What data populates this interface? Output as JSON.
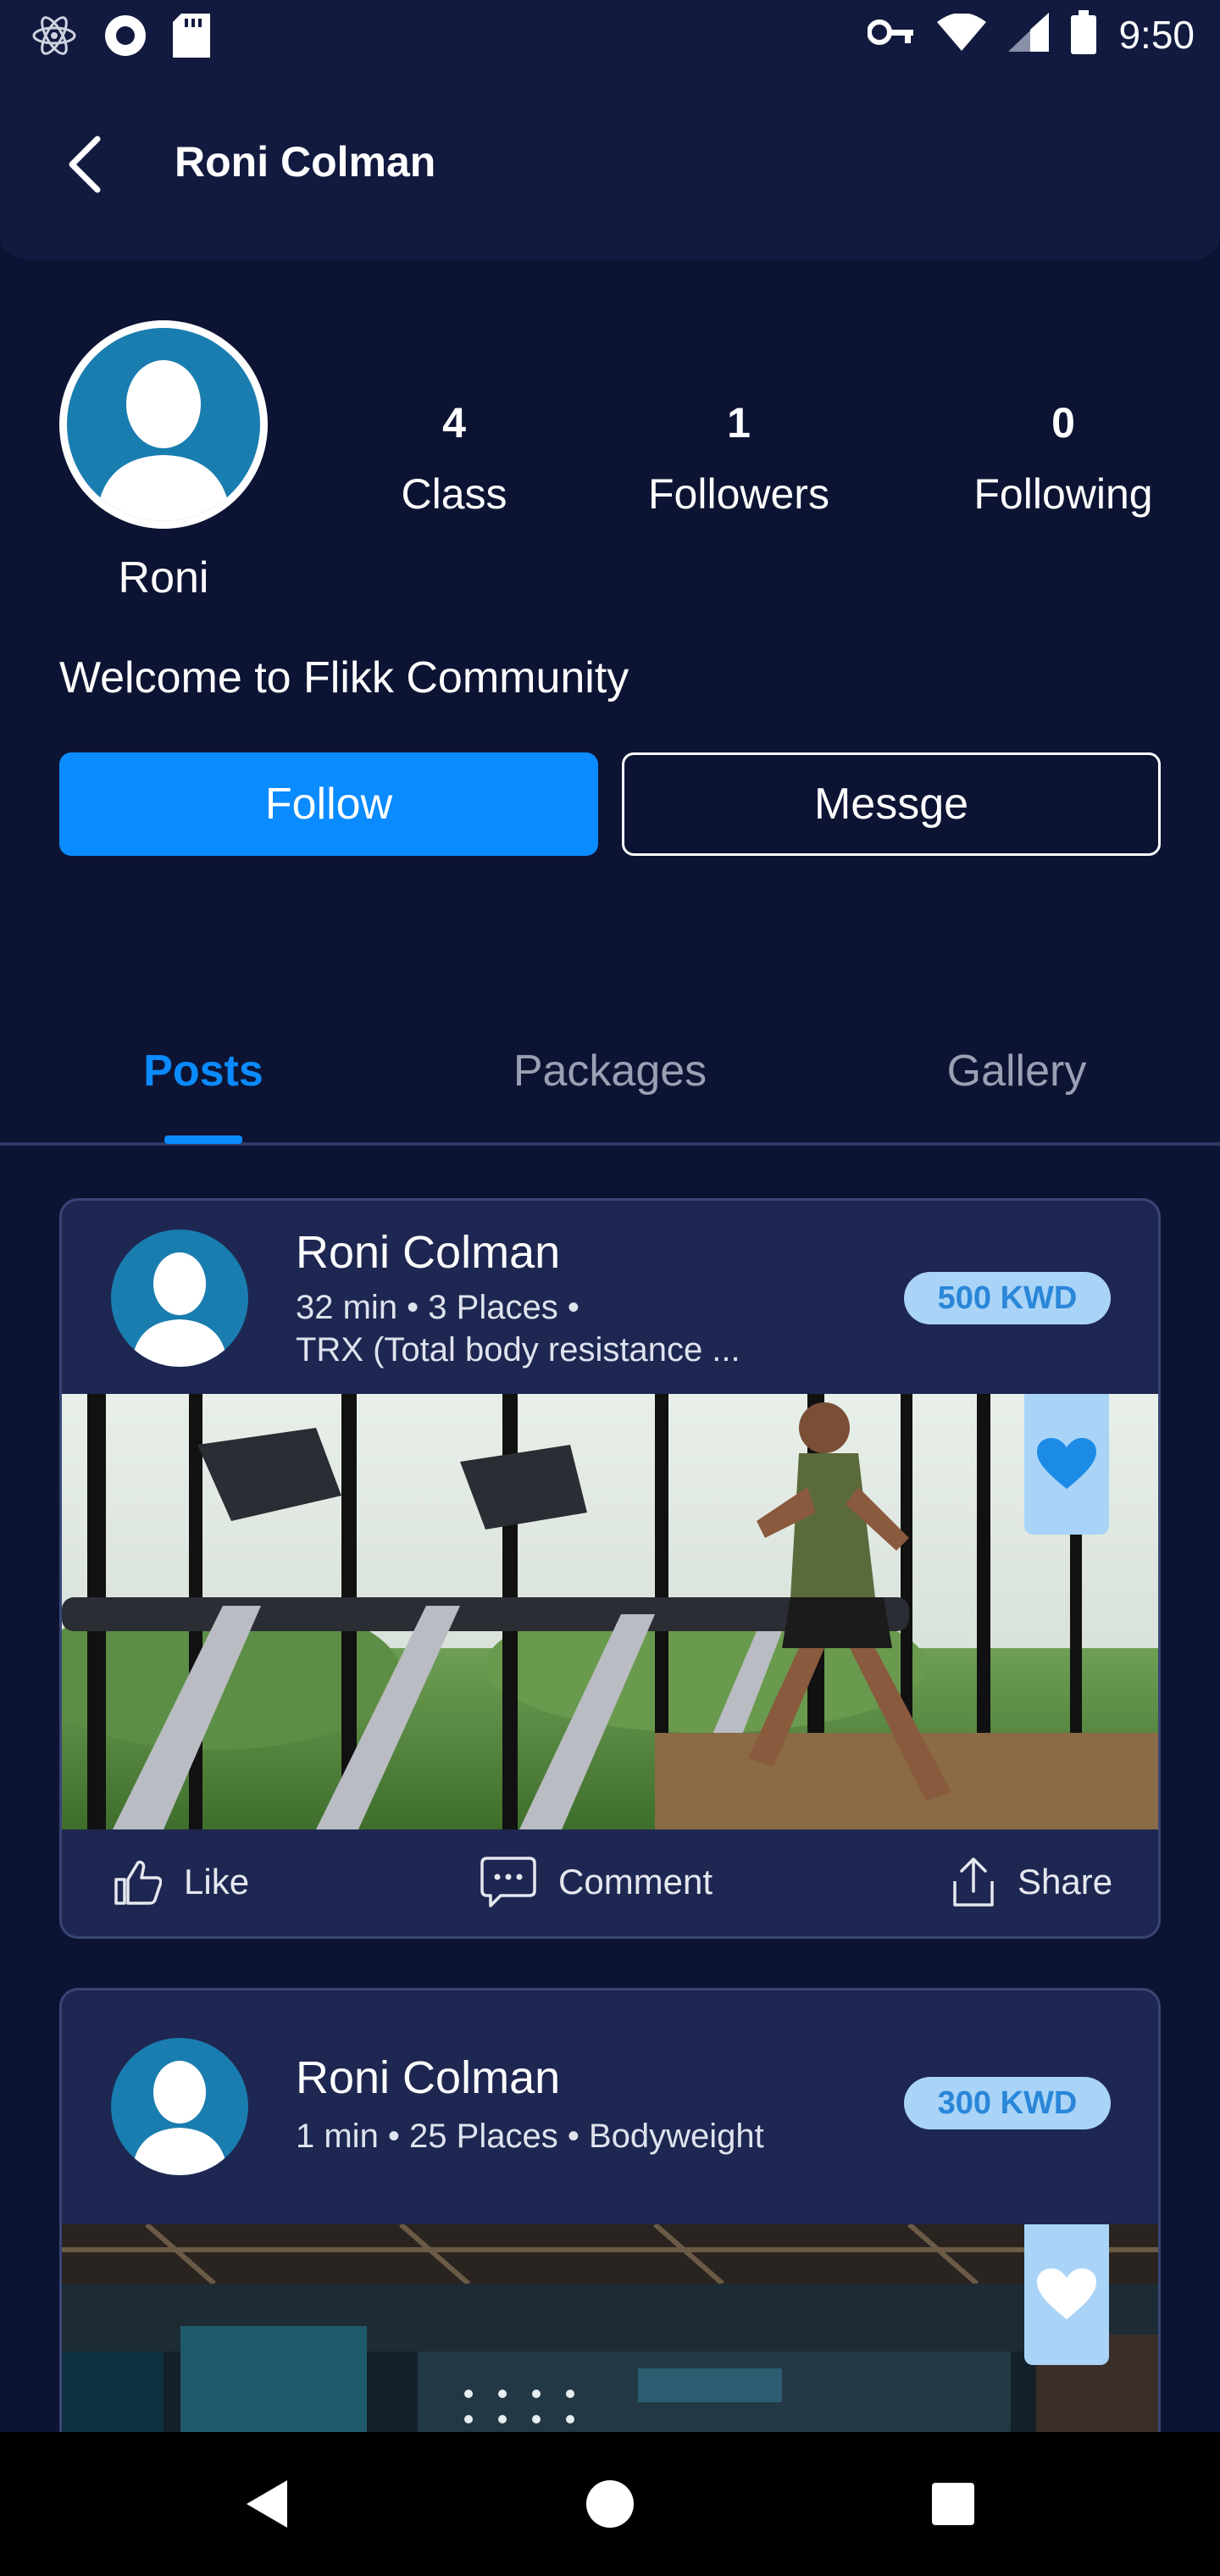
{
  "status_bar": {
    "time": "9:50"
  },
  "header": {
    "title": "Roni Colman"
  },
  "profile": {
    "name": "Roni",
    "bio": "Welcome to Flikk Community",
    "stats": [
      {
        "value": "4",
        "label": "Class"
      },
      {
        "value": "1",
        "label": "Followers"
      },
      {
        "value": "0",
        "label": "Following"
      }
    ],
    "follow_label": "Follow",
    "message_label": "Messge"
  },
  "tabs": [
    {
      "label": "Posts",
      "active": true
    },
    {
      "label": "Packages",
      "active": false
    },
    {
      "label": "Gallery",
      "active": false
    }
  ],
  "posts": [
    {
      "author": "Roni Colman",
      "meta": "32 min • 3 Places •",
      "subtitle": "TRX (Total body resistance ...",
      "price": "500 KWD",
      "favorited": true,
      "like_label": "Like",
      "comment_label": "Comment",
      "share_label": "Share"
    },
    {
      "author": "Roni Colman",
      "meta": "1 min • 25 Places • Bodyweight",
      "price": "300 KWD",
      "favorited": false
    }
  ],
  "colors": {
    "background": "#0d1433",
    "header": "#121a3f",
    "card": "#1e2751",
    "accent": "#0a8bff",
    "badge_bg": "#a9d4f7"
  },
  "icons": {
    "status_left": [
      "atom-icon",
      "record-icon",
      "sd-card-icon"
    ],
    "status_right": [
      "key-icon",
      "wifi-icon",
      "signal-icon",
      "battery-icon"
    ],
    "nav": [
      "nav-back-icon",
      "nav-home-icon",
      "nav-recent-icon"
    ]
  }
}
